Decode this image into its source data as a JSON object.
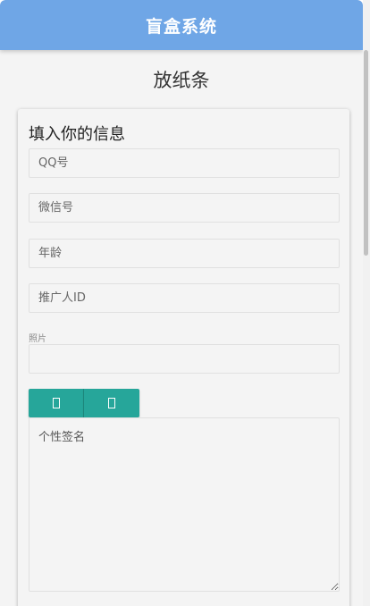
{
  "header": {
    "title": "盲盒系统"
  },
  "page": {
    "title": "放纸条"
  },
  "form": {
    "heading": "填入你的信息",
    "qq_placeholder": "QQ号",
    "wechat_placeholder": "微信号",
    "age_placeholder": "年龄",
    "promoter_placeholder": "推广人ID",
    "photo_label": "照片",
    "photo_value": "",
    "signature_placeholder": "个性签名"
  },
  "colors": {
    "header_bg": "#6fa6e6",
    "button_bg": "#26a69a",
    "page_bg": "#f4f4f4"
  },
  "icons": [
    "missing-glyph-icon",
    "missing-glyph-icon"
  ]
}
